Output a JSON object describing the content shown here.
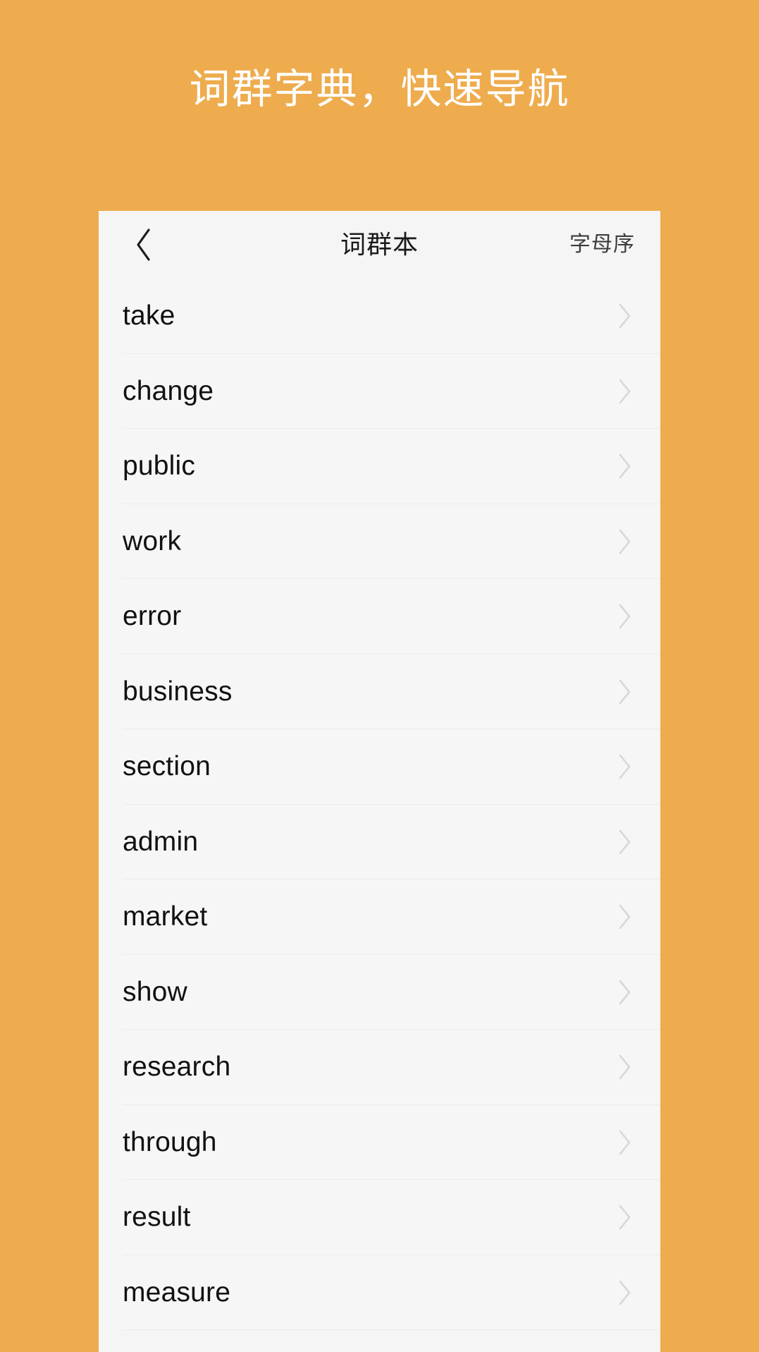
{
  "promo": {
    "headline": "词群字典，快速导航",
    "background_color": "#eeac4e",
    "headline_color": "#ffffff"
  },
  "phone": {
    "card_background": "#f5f5f5",
    "navbar": {
      "back_icon": "chevron-left-icon",
      "title": "词群本",
      "action_label": "字母序",
      "title_color": "#1a1a1a",
      "action_color": "#3c3c3c"
    },
    "list": {
      "row_chevron_icon": "chevron-right-icon",
      "divider_color": "#ececec",
      "items": [
        {
          "word": "take"
        },
        {
          "word": "change"
        },
        {
          "word": "public"
        },
        {
          "word": "work"
        },
        {
          "word": "error"
        },
        {
          "word": "business"
        },
        {
          "word": "section"
        },
        {
          "word": "admin"
        },
        {
          "word": "market"
        },
        {
          "word": "show"
        },
        {
          "word": "research"
        },
        {
          "word": "through"
        },
        {
          "word": "result"
        },
        {
          "word": "measure"
        }
      ]
    }
  }
}
